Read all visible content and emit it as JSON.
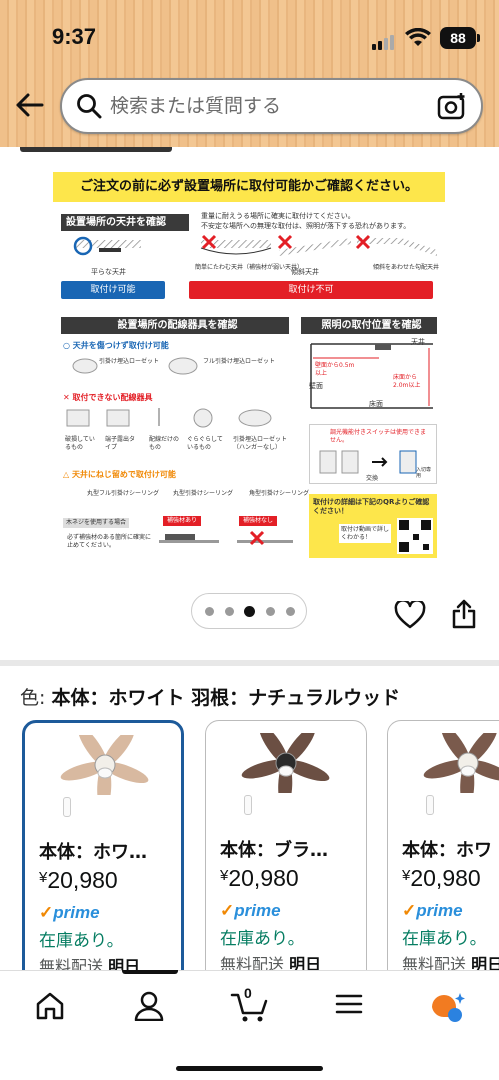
{
  "status_bar": {
    "time": "9:37",
    "battery": "88"
  },
  "search": {
    "placeholder": "検索または質問する"
  },
  "infographic": {
    "banner": "ご注文の前に必ず設置場所に取付可能かご確認ください。",
    "ceiling": {
      "header": "設置場所の天井を確認",
      "note1": "重量に耐えうる場所に確実に取付けてください。",
      "note2": "不安定な場所への無理な取付は、照明が落下する恐れがあります。",
      "ok_caption": "平らな天井",
      "ng1_caption": "簡単にたわむ天井（補強材が弱い天井）",
      "ng2_caption": "傾斜天井",
      "ng3_caption": "傾斜をあわせた勾配天井",
      "ok_label": "取付け可能",
      "ng_label": "取付け不可"
    },
    "wiring": {
      "header": "設置場所の配線器具を確認",
      "ok_title": "天井を傷つけず取付け可能",
      "ok_item1": "引掛け埋込ローゼット",
      "ok_item2": "フル引掛け埋込ローゼット",
      "ng_title": "取付できない配線器具",
      "ng_item1": "破損しているもの",
      "ng_item2": "端子露出タイプ",
      "ng_item3": "配線だけのもの",
      "ng_item4": "ぐらぐらしているもの",
      "ng_item5": "引掛埋込ローゼット（ハンガーなし）",
      "warn_title": "天井にねじ留めで取付け可能",
      "warn_item1": "丸型フル引掛けシーリング",
      "warn_item2": "丸型引掛けシーリング",
      "warn_item3": "角型引掛けシーリング",
      "screw_title": "木ネジを使用する場合",
      "screw_note": "必ず補強材のある箇所に確実に止めてください。",
      "reinforce_ok": "補強材あり",
      "reinforce_ng": "補強材なし"
    },
    "position": {
      "header": "照明の取付位置を確認",
      "ceiling_label": "天井",
      "wall_label": "壁面",
      "floor_label": "床面",
      "from_wall": "壁面から0.5m以上",
      "from_floor": "床面から2.0m以上",
      "dimmer_note": "調光機能付きスイッチは使用できません。",
      "exchange_label": "交換",
      "switch_label": "入切専用",
      "qr_note": "取付けの詳細は下記のQRよりご確認ください！",
      "video_note": "取付け動画で詳しくわかる！"
    }
  },
  "gallery": {
    "total_dots": 5,
    "active_index": 2
  },
  "variation": {
    "label": "色:",
    "selected_value": "本体：ホワイト 羽根：ナチュラルウッド",
    "cards": [
      {
        "name": "本体：ホワ…",
        "currency": "¥",
        "price": "20,980",
        "prime": "prime",
        "stock": "在庫あり。",
        "shipping": "無料配送",
        "shipping_day": "明日",
        "selected": true,
        "body_color": "#f2efe9",
        "blade_color": "#d8b9a0"
      },
      {
        "name": "本体：ブラ…",
        "currency": "¥",
        "price": "20,980",
        "prime": "prime",
        "stock": "在庫あり。",
        "shipping": "無料配送",
        "shipping_day": "明日",
        "selected": false,
        "body_color": "#2b2b2b",
        "blade_color": "#6b4f43"
      },
      {
        "name": "本体：ホワ",
        "currency": "¥",
        "price": "20,980",
        "prime": "prime",
        "stock": "在庫あり。",
        "shipping": "無料配送",
        "shipping_day": "明日",
        "selected": false,
        "body_color": "#f2efe9",
        "blade_color": "#7a5a4c"
      }
    ]
  },
  "bottom_nav": {
    "cart_count": "0"
  },
  "colors": {
    "accent_blue": "#1d5a9a",
    "stock_green": "#067d62",
    "prime_blue": "#2a8fdb",
    "banner_yellow": "#fde64b",
    "ng_red": "#e31f26"
  }
}
